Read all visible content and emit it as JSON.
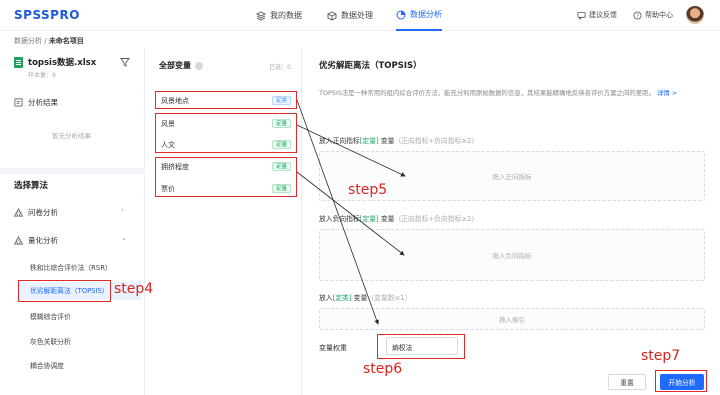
{
  "header": {
    "logo": "SPSSPRO",
    "nav": [
      "我的数据",
      "数据处理",
      "数据分析"
    ],
    "active_nav": "数据分析",
    "feedback": "建议反馈",
    "help": "帮助中心",
    "accent_color": "#1f6bff"
  },
  "breadcrumb": {
    "root": "数据分析",
    "sep": " / ",
    "current": "未命名项目"
  },
  "sidebar": {
    "file_name": "topsis数据.xlsx",
    "file_meta": "样本量：9",
    "results_label": "分析结果",
    "results_empty": "暂无分析结果",
    "algo_title": "选择算法",
    "groups": [
      {
        "label": "问卷分析",
        "icon": "triangle-cluster-icon"
      },
      {
        "label": "量化分析",
        "icon": "triangle-cluster-icon"
      }
    ],
    "items": [
      "秩和比综合评价法（RSR）",
      "优劣解距离法（TOPSIS）",
      "模糊综合评价",
      "灰色关联分析",
      "耦合协调度"
    ]
  },
  "variables": {
    "title": "全部变量",
    "count": "已选：0",
    "list": [
      {
        "name": "风景地点",
        "type": "定类",
        "type_color": "blue"
      },
      {
        "name": "风景",
        "type": "定量",
        "type_color": "green"
      },
      {
        "name": "人文",
        "type": "定量",
        "type_color": "green"
      },
      {
        "name": "拥挤程度",
        "type": "定量",
        "type_color": "green"
      },
      {
        "name": "票价",
        "type": "定量",
        "type_color": "green"
      }
    ]
  },
  "main": {
    "title": "优劣解距离法（TOPSIS）",
    "description": "TOPSIS法是一种常用的组内综合评价方法，能充分利用原始数据的信息，其结果能精确地反映各评价方案之间的差距。",
    "detail_link": "详情 >",
    "positive": {
      "prefix": "放入正向指标",
      "dl": "[定量]",
      "suffix": " 变量",
      "hint": "（正向指标+负向指标≥2）",
      "placeholder": "拖入正向指标"
    },
    "negative": {
      "prefix": "放入负向指标",
      "dl": "[定量]",
      "suffix": " 变量",
      "hint": "（正向指标+负向指标≥2）",
      "placeholder": "拖入负向指标"
    },
    "index": {
      "prefix": "放入",
      "dl": "[定类]",
      "suffix": " 变量",
      "hint": "（变量数≤1）",
      "placeholder": "拖入索引"
    },
    "weight_label": "变量权重",
    "weight_value": "熵权法",
    "reset_label": "重置",
    "start_label": "开始分析"
  },
  "annotations": {
    "step4": "step4",
    "step5": "step5",
    "step6": "step6",
    "step7": "step7",
    "color": "#d6261f"
  }
}
